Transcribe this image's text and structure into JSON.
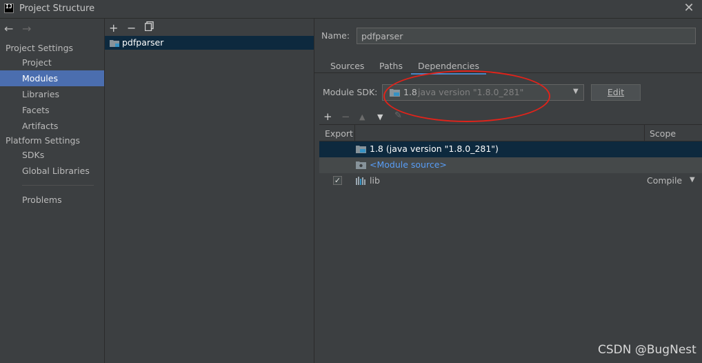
{
  "window": {
    "title": "Project Structure",
    "logo_text": "IJ"
  },
  "sidebar": {
    "project_settings_heading": "Project Settings",
    "project_settings_items": [
      {
        "label": "Project",
        "selected": false
      },
      {
        "label": "Modules",
        "selected": true
      },
      {
        "label": "Libraries",
        "selected": false
      },
      {
        "label": "Facets",
        "selected": false
      },
      {
        "label": "Artifacts",
        "selected": false
      }
    ],
    "platform_settings_heading": "Platform Settings",
    "platform_settings_items": [
      {
        "label": "SDKs"
      },
      {
        "label": "Global Libraries"
      }
    ],
    "problems_label": "Problems"
  },
  "modules": {
    "items": [
      {
        "name": "pdfparser",
        "selected": true
      }
    ]
  },
  "detail": {
    "name_label": "Name:",
    "name_value": "pdfparser",
    "tabs": [
      {
        "label": "Sources",
        "active": false
      },
      {
        "label": "Paths",
        "active": false
      },
      {
        "label": "Dependencies",
        "active": true
      }
    ],
    "sdk_label": "Module SDK:",
    "sdk_name": "1.8",
    "sdk_version": "java version \"1.8.0_281\"",
    "edit_label": "Edit",
    "table": {
      "headers": {
        "export": "Export",
        "scope": "Scope"
      },
      "rows": [
        {
          "text": "1.8 (java version \"1.8.0_281\")",
          "icon": "jdk-folder-icon",
          "selected": true
        },
        {
          "text": "<Module source>",
          "icon": "module-source-icon",
          "color": "#589df6"
        },
        {
          "text": "lib",
          "icon": "library-icon",
          "checked": true,
          "scope": "Compile"
        }
      ]
    }
  },
  "watermark": "CSDN @BugNest",
  "colors": {
    "selection": "#4b6eaf",
    "row_selected": "#0d293e",
    "link": "#589df6",
    "annotation": "#e2231a"
  }
}
